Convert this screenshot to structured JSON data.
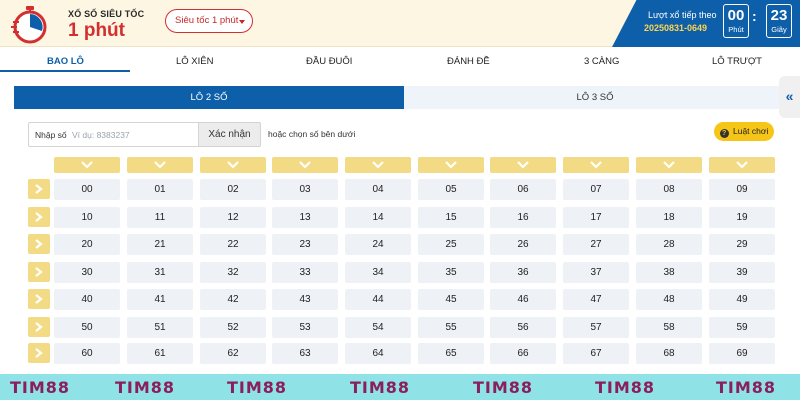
{
  "header": {
    "logo_small": "XỔ SỐ SIÊU TỐC",
    "logo_big": "1 phút",
    "speed_select": "Siêu tốc 1 phút",
    "timer": {
      "label": "Lượt xổ tiếp theo",
      "draw_id": "20250831-0649",
      "minutes": "00",
      "minutes_unit": "Phút",
      "seconds": "23",
      "seconds_unit": "Giây"
    }
  },
  "nav": {
    "tabs": [
      {
        "label": "BAO LÔ",
        "active": true
      },
      {
        "label": "LÔ XIÊN"
      },
      {
        "label": "ĐẦU ĐUÔI"
      },
      {
        "label": "ĐÁNH ĐỀ"
      },
      {
        "label": "3 CÀNG"
      },
      {
        "label": "LÔ TRƯỢT"
      }
    ]
  },
  "subtabs": [
    {
      "label": "LÔ 2 SỐ",
      "active": true
    },
    {
      "label": "LÔ 3 SỐ"
    }
  ],
  "input": {
    "label": "Nhập số",
    "placeholder": "Ví dụ: 8383237",
    "confirm": "Xác nhận",
    "hint_prefix": "hoặc",
    "hint_rest": "chọn số bên dưới",
    "rules": "Luật chơi"
  },
  "grid": {
    "rows": [
      [
        "00",
        "01",
        "02",
        "03",
        "04",
        "05",
        "06",
        "07",
        "08",
        "09"
      ],
      [
        "10",
        "11",
        "12",
        "13",
        "14",
        "15",
        "16",
        "17",
        "18",
        "19"
      ],
      [
        "20",
        "21",
        "22",
        "23",
        "24",
        "25",
        "26",
        "27",
        "28",
        "29"
      ],
      [
        "30",
        "31",
        "32",
        "33",
        "34",
        "35",
        "36",
        "37",
        "38",
        "39"
      ],
      [
        "40",
        "41",
        "42",
        "43",
        "44",
        "45",
        "46",
        "47",
        "48",
        "49"
      ],
      [
        "50",
        "51",
        "52",
        "53",
        "54",
        "55",
        "56",
        "57",
        "58",
        "59"
      ],
      [
        "60",
        "61",
        "62",
        "63",
        "64",
        "65",
        "66",
        "67",
        "68",
        "69"
      ]
    ]
  },
  "colors": {
    "primary": "#0e5fa9",
    "accent": "#f3da85",
    "brand_red": "#d32f2f",
    "band": "#8fe3e6",
    "watermark": "#8b1e5c"
  },
  "watermark": [
    "TIM88",
    "TIM88",
    "TIM88",
    "TIM88",
    "TIM88",
    "TIM88",
    "TIM88"
  ]
}
